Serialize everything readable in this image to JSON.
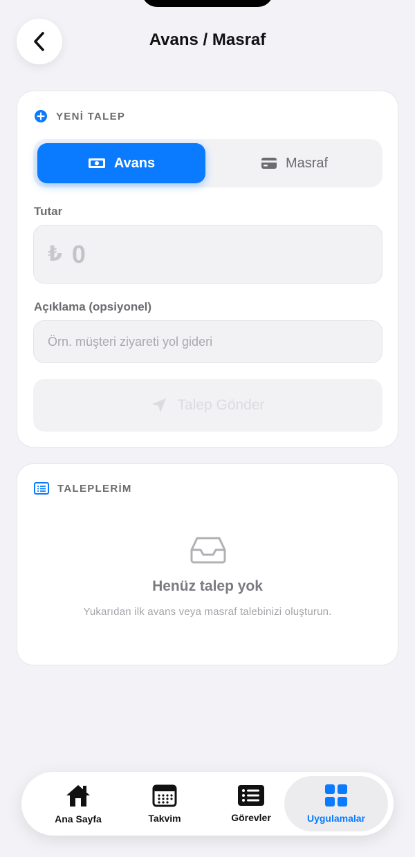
{
  "header": {
    "title": "Avans / Masraf"
  },
  "new_request": {
    "section_title": "YENİ TALEP",
    "segments": {
      "advance": "Avans",
      "expense": "Masraf",
      "selected": "Avans"
    },
    "amount": {
      "label": "Tutar",
      "currency_symbol": "₺",
      "value": "0"
    },
    "description": {
      "label": "Açıklama (opsiyonel)",
      "placeholder": "Örn. müşteri ziyareti yol gideri",
      "value": ""
    },
    "submit_label": "Talep Gönder"
  },
  "my_requests": {
    "section_title": "TALEPLERİM",
    "empty_title": "Henüz talep yok",
    "empty_subtitle": "Yukarıdan ilk avans veya masraf talebinizi oluşturun."
  },
  "tabbar": {
    "items": [
      {
        "label": "Ana Sayfa",
        "icon": "house-icon"
      },
      {
        "label": "Takvim",
        "icon": "calendar-icon"
      },
      {
        "label": "Görevler",
        "icon": "list-icon"
      },
      {
        "label": "Uygulamalar",
        "icon": "grid-icon"
      }
    ],
    "active": "Uygulamalar"
  },
  "colors": {
    "accent": "#0a7aff",
    "background": "#f2f2f7",
    "muted_text": "#6b6b70"
  }
}
